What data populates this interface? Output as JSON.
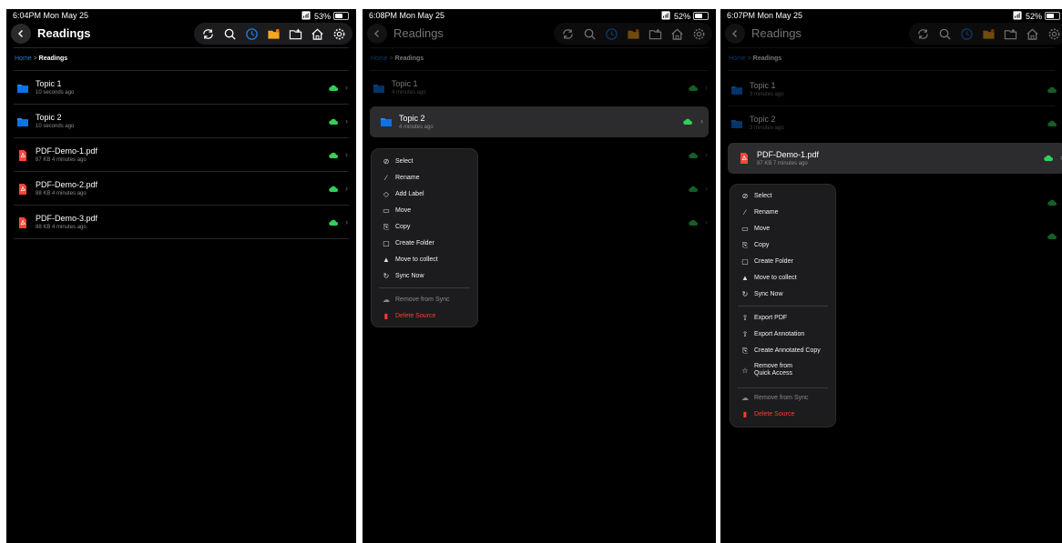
{
  "colors": {
    "accent": "#1f7ae0",
    "folder": "#1a8cff",
    "pdf": "#ff453a",
    "cloud": "#30d158",
    "danger": "#ff3b30"
  },
  "screens": [
    {
      "status": {
        "time": "6:04PM  Mon May 25",
        "battery": "53%"
      },
      "title": "Readings",
      "breadcrumb": {
        "home": "Home",
        "sep": " > ",
        "current": "Readings"
      },
      "rows": [
        {
          "name": "Topic 1",
          "sub": "10 seconds ago",
          "type": "folder"
        },
        {
          "name": "Topic 2",
          "sub": "10 seconds ago",
          "type": "folder"
        },
        {
          "name": "PDF-Demo-1.pdf",
          "sub": "87 KB  4 minutes ago",
          "type": "pdf"
        },
        {
          "name": "PDF-Demo-2.pdf",
          "sub": "88 KB  4 minutes ago",
          "type": "pdf"
        },
        {
          "name": "PDF-Demo-3.pdf",
          "sub": "88 KB  4 minutes ago",
          "type": "pdf"
        }
      ]
    },
    {
      "status": {
        "time": "6:08PM  Mon May 25",
        "battery": "52%"
      },
      "title": "Readings",
      "breadcrumb": {
        "home": "Home",
        "sep": " > ",
        "current": "Readings"
      },
      "rows": [
        {
          "name": "Topic 1",
          "sub": "4 minutes ago",
          "type": "folder"
        },
        {
          "name": "Topic 2",
          "sub": "4 minutes ago",
          "type": "folder"
        }
      ],
      "menu": {
        "items": [
          "Select",
          "Rename",
          "Add Label",
          "Move",
          "Copy",
          "Create Folder",
          "Move to collect",
          "Sync Now"
        ],
        "disabled": "Remove from Sync",
        "danger": "Delete Source"
      }
    },
    {
      "status": {
        "time": "6:07PM  Mon May 25",
        "battery": "52%"
      },
      "title": "Readings",
      "breadcrumb": {
        "home": "Home",
        "sep": " > ",
        "current": "Readings"
      },
      "rows": [
        {
          "name": "Topic 1",
          "sub": "3 minutes ago",
          "type": "folder"
        },
        {
          "name": "Topic 2",
          "sub": "3 minutes ago",
          "type": "folder"
        },
        {
          "name": "PDF-Demo-1.pdf",
          "sub": "87 KB  7 minutes ago",
          "type": "pdf"
        }
      ],
      "menu": {
        "items": [
          "Select",
          "Rename",
          "Move",
          "Copy",
          "Create Folder",
          "Move to collect",
          "Sync Now"
        ],
        "items2": [
          "Export PDF",
          "Export Annotation",
          "Create Annotated Copy",
          "Remove from Quick Access"
        ],
        "disabled": "Remove from Sync",
        "danger": "Delete Source"
      }
    }
  ],
  "icons": [
    "chevron-left-icon",
    "sync-icon",
    "search-icon",
    "recent-clock-icon",
    "folder-star-icon",
    "new-folder-icon",
    "home-icon",
    "gear-icon",
    "cloud-icon",
    "chevron-right-icon",
    "folder-icon",
    "pdf-icon"
  ]
}
